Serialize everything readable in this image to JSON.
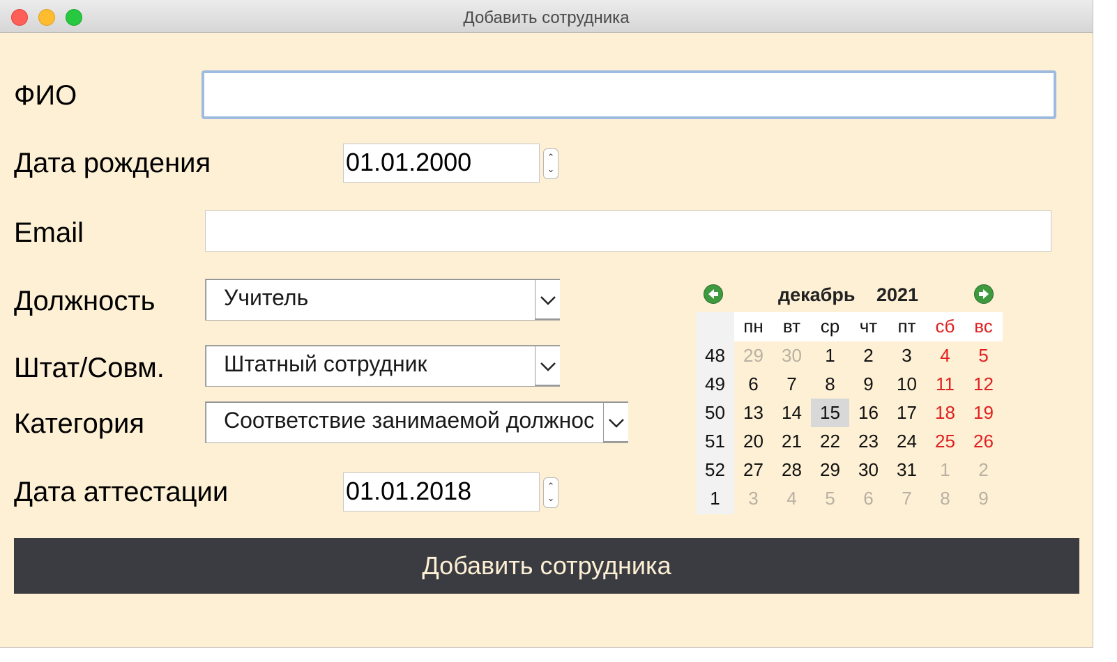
{
  "window": {
    "title": "Добавить сотрудника"
  },
  "form": {
    "fio_label": "ФИО",
    "fio_value": "",
    "birth_label": "Дата рождения",
    "birth_value": "01.01.2000",
    "email_label": "Email",
    "email_value": "",
    "position_label": "Должность",
    "position_value": "Учитель",
    "employment_label": "Штат/Совм.",
    "employment_value": "Штатный сотрудник",
    "category_label": "Категория",
    "category_value": "Соответствие занимаемой должнос",
    "attestation_label": "Дата аттестации",
    "attestation_value": "01.01.2018",
    "submit_label": "Добавить сотрудника"
  },
  "calendar": {
    "month": "декабрь",
    "year": "2021",
    "weekdays": [
      "пн",
      "вт",
      "ср",
      "чт",
      "пт",
      "сб",
      "вс"
    ],
    "selected_day": 15,
    "rows": [
      {
        "week": "48",
        "days": [
          {
            "d": "29",
            "other": true
          },
          {
            "d": "30",
            "other": true
          },
          {
            "d": "1"
          },
          {
            "d": "2"
          },
          {
            "d": "3"
          },
          {
            "d": "4"
          },
          {
            "d": "5"
          }
        ]
      },
      {
        "week": "49",
        "days": [
          {
            "d": "6"
          },
          {
            "d": "7"
          },
          {
            "d": "8"
          },
          {
            "d": "9"
          },
          {
            "d": "10"
          },
          {
            "d": "11"
          },
          {
            "d": "12"
          }
        ]
      },
      {
        "week": "50",
        "days": [
          {
            "d": "13"
          },
          {
            "d": "14"
          },
          {
            "d": "15",
            "selected": true
          },
          {
            "d": "16"
          },
          {
            "d": "17"
          },
          {
            "d": "18"
          },
          {
            "d": "19"
          }
        ]
      },
      {
        "week": "51",
        "days": [
          {
            "d": "20"
          },
          {
            "d": "21"
          },
          {
            "d": "22"
          },
          {
            "d": "23"
          },
          {
            "d": "24"
          },
          {
            "d": "25"
          },
          {
            "d": "26"
          }
        ]
      },
      {
        "week": "52",
        "days": [
          {
            "d": "27"
          },
          {
            "d": "28"
          },
          {
            "d": "29"
          },
          {
            "d": "30"
          },
          {
            "d": "31"
          },
          {
            "d": "1",
            "other": true
          },
          {
            "d": "2",
            "other": true
          }
        ]
      },
      {
        "week": "1",
        "days": [
          {
            "d": "3",
            "other": true
          },
          {
            "d": "4",
            "other": true
          },
          {
            "d": "5",
            "other": true
          },
          {
            "d": "6",
            "other": true
          },
          {
            "d": "7",
            "other": true
          },
          {
            "d": "8",
            "other": true
          },
          {
            "d": "9",
            "other": true
          }
        ]
      }
    ]
  },
  "colors": {
    "window_bg": "#fdf0d4",
    "weekend": "#e02020",
    "button_bg": "#3b3c41",
    "focus_ring": "#9dbbe0"
  },
  "icons": {
    "prev": "arrow-left-circle-icon",
    "next": "arrow-right-circle-icon"
  }
}
